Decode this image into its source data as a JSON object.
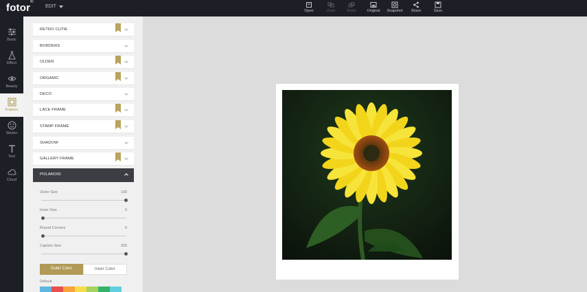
{
  "app": {
    "logo": "fotor",
    "logo_mark": "®",
    "menu": "EDIT"
  },
  "toolbar": [
    {
      "key": "open",
      "label": "Open",
      "icon": "open-icon",
      "enabled": true
    },
    {
      "key": "undo",
      "label": "Undo",
      "icon": "undo-icon",
      "enabled": false
    },
    {
      "key": "redo",
      "label": "Redo",
      "icon": "redo-icon",
      "enabled": false
    },
    {
      "key": "original",
      "label": "Original",
      "icon": "original-icon",
      "enabled": true
    },
    {
      "key": "snapshot",
      "label": "Snapshot",
      "icon": "snapshot-icon",
      "enabled": true
    },
    {
      "key": "share",
      "label": "Share",
      "icon": "share-icon",
      "enabled": true
    },
    {
      "key": "save",
      "label": "Save",
      "icon": "save-icon",
      "enabled": true
    }
  ],
  "rail": [
    {
      "label": "Basic",
      "icon": "sliders-icon"
    },
    {
      "label": "Effect",
      "icon": "flask-icon"
    },
    {
      "label": "Beauty",
      "icon": "eye-icon"
    },
    {
      "label": "Frames",
      "icon": "frame-icon",
      "active": true
    },
    {
      "label": "Sticker",
      "icon": "sticker-icon"
    },
    {
      "label": "Text",
      "icon": "text-icon"
    },
    {
      "label": "Cloud",
      "icon": "cloud-icon"
    }
  ],
  "frames": [
    {
      "label": "RETRO CUTIE",
      "premium": true
    },
    {
      "label": "BORDERS",
      "premium": false
    },
    {
      "label": "OLDEN",
      "premium": true
    },
    {
      "label": "ORGANIC",
      "premium": true
    },
    {
      "label": "DECO",
      "premium": false
    },
    {
      "label": "LACE FRAME",
      "premium": true
    },
    {
      "label": "STAMP FRAME",
      "premium": true
    },
    {
      "label": "SHADOW",
      "premium": false
    },
    {
      "label": "GALLERY FRAME",
      "premium": true
    },
    {
      "label": "POLAROID",
      "premium": false,
      "open": true
    }
  ],
  "sliders": [
    {
      "label": "Outer Size",
      "value": "100",
      "position": 1.0
    },
    {
      "label": "Inner Size",
      "value": "0",
      "position": 0.0
    },
    {
      "label": "Round Corners",
      "value": "0",
      "position": 0.0
    },
    {
      "label": "Caption Size",
      "value": "200",
      "position": 1.0
    }
  ],
  "color_tabs": {
    "outer": "Outer Color",
    "inner": "Inner Color"
  },
  "palette": {
    "label": "Default",
    "colors": [
      "#5fb7e0",
      "#e84f4f",
      "#f6a43a",
      "#f7dc4a",
      "#a6d25e",
      "#36b36a",
      "#62cfe0"
    ]
  },
  "colors": {
    "accent": "#b09a55",
    "dark": "#1d1f26"
  }
}
